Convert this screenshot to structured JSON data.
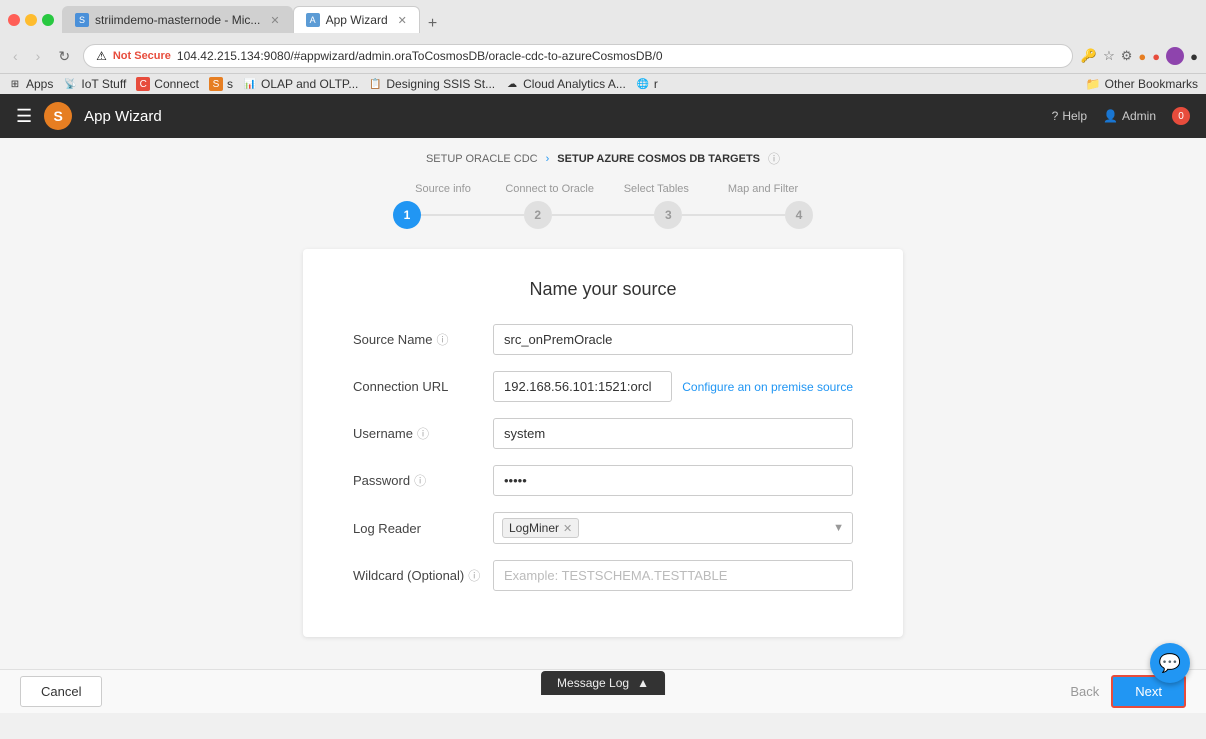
{
  "browser": {
    "tabs": [
      {
        "id": "tab1",
        "label": "striimdemo-masternode - Mic...",
        "favicon": "S",
        "active": false
      },
      {
        "id": "tab2",
        "label": "App Wizard",
        "favicon": "A",
        "active": true
      }
    ],
    "address": {
      "not_secure_label": "Not Secure",
      "url": "104.42.215.134:9080/#appwizard/admin.oraToCosmosDB/oracle-cdc-to-azureCosmosDB/0"
    },
    "bookmarks": [
      {
        "label": "Apps"
      },
      {
        "label": "IoT Stuff"
      },
      {
        "label": "Connect"
      },
      {
        "label": "s"
      },
      {
        "label": "OLAP and OLTP..."
      },
      {
        "label": "Designing SSIS St..."
      },
      {
        "label": "Cloud Analytics A..."
      },
      {
        "label": "r"
      }
    ],
    "other_bookmarks": "Other Bookmarks"
  },
  "app": {
    "title": "App Wizard",
    "logo_letter": "S",
    "help_label": "Help",
    "admin_label": "Admin",
    "notification_count": "0"
  },
  "breadcrumb": {
    "step1": "SETUP ORACLE CDC",
    "arrow": "›",
    "step2": "SETUP AZURE COSMOS DB TARGETS",
    "info_icon": "ⓘ"
  },
  "wizard": {
    "steps": [
      {
        "number": "1",
        "label": "Source info",
        "state": "active"
      },
      {
        "number": "2",
        "label": "Connect to Oracle",
        "state": "inactive"
      },
      {
        "number": "3",
        "label": "Select Tables",
        "state": "inactive"
      },
      {
        "number": "4",
        "label": "Map and Filter",
        "state": "inactive"
      }
    ]
  },
  "form": {
    "title": "Name your source",
    "fields": [
      {
        "id": "source_name",
        "label": "Source Name",
        "has_info": true,
        "type": "text",
        "value": "src_onPremOracle",
        "placeholder": ""
      },
      {
        "id": "connection_url",
        "label": "Connection URL",
        "has_info": false,
        "type": "text",
        "value": "192.168.56.101:1521:orcl",
        "placeholder": "",
        "link": "Configure an on premise source"
      },
      {
        "id": "username",
        "label": "Username",
        "has_info": true,
        "type": "text",
        "value": "system",
        "placeholder": ""
      },
      {
        "id": "password",
        "label": "Password",
        "has_info": true,
        "type": "password",
        "value": "•••••",
        "placeholder": ""
      },
      {
        "id": "log_reader",
        "label": "Log Reader",
        "has_info": false,
        "type": "select",
        "selected_value": "LogMiner"
      },
      {
        "id": "wildcard",
        "label": "Wildcard (Optional)",
        "has_info": true,
        "type": "text",
        "value": "",
        "placeholder": "Example: TESTSCHEMA.TESTTABLE"
      }
    ]
  },
  "footer": {
    "cancel_label": "Cancel",
    "back_label": "Back",
    "next_label": "Next"
  },
  "message_log": {
    "label": "Message Log",
    "icon": "▲"
  },
  "chat_icon": "💬"
}
